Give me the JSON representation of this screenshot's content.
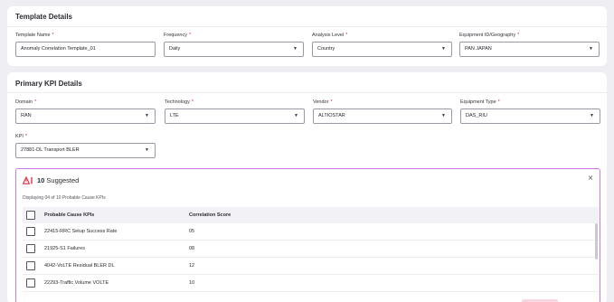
{
  "template_details": {
    "title": "Template Details",
    "fields": [
      {
        "label": "Template Name",
        "required": "*",
        "value": "Anomaly Correlation Template_01",
        "type": "text"
      },
      {
        "label": "Frequency",
        "required": "*",
        "value": "Daily",
        "type": "select"
      },
      {
        "label": "Analysis Level",
        "required": "*",
        "value": "Country",
        "type": "select"
      },
      {
        "label": "Equipment ID/Geography",
        "required": "*",
        "value": "PAN JAPAN",
        "type": "select"
      }
    ]
  },
  "primary_kpi": {
    "title": "Primary KPI Details",
    "fields": [
      {
        "label": "Domain",
        "required": "*",
        "value": "RAN"
      },
      {
        "label": "Technology",
        "required": "*",
        "value": "LTE"
      },
      {
        "label": "Vendor",
        "required": "*",
        "value": "ALTIOSTAR"
      },
      {
        "label": "Equipment Type",
        "required": "*",
        "value": "DAS_RIU"
      },
      {
        "label": "KPI",
        "required": "*",
        "value": "27881-DL  Transport BLER"
      }
    ]
  },
  "suggestions": {
    "count": "10",
    "label": " Suggested",
    "displaying": "Displaying 04 of 10 Probable Cause KPIs",
    "close_icon": "×",
    "columns": [
      "Probable Cause KPIs",
      "Correlation Score"
    ],
    "rows": [
      {
        "kpi": "22415-RRC Setup Success Rate",
        "score": "05"
      },
      {
        "kpi": "21925-S1 Failures",
        "score": "08"
      },
      {
        "kpi": "4042-VoLTE Residual BLER DL",
        "score": "12"
      },
      {
        "kpi": "22293-Traffic Volume VOLTE",
        "score": "10"
      }
    ]
  },
  "icons": {
    "caret": "▼",
    "suggest_icon": "alert-sparkle-icon"
  },
  "colors": {
    "accent": "#e0233a",
    "panel_border": "#c97ae8"
  }
}
